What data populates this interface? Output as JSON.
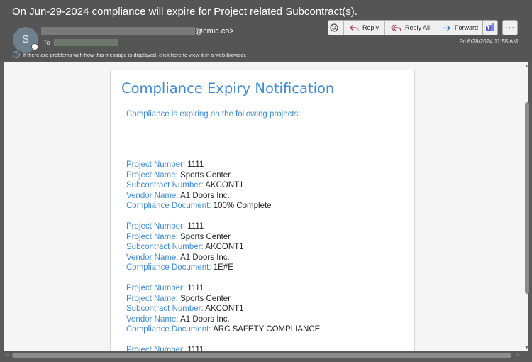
{
  "email": {
    "subject": "On Jun-29-2024 compliance will expire for Project related Subcontract(s).",
    "avatar_initial": "S",
    "sender_domain": "@cmic.ca>",
    "to_label": "To",
    "info_bar": "If there are problems with how this message is displayed, click here to view it in a web browser.",
    "date": "Fri 6/28/2024 11:55 AM"
  },
  "actions": {
    "reply": "Reply",
    "reply_all": "Reply All",
    "forward": "Forward",
    "more": "···"
  },
  "icons": {
    "emoji": "emoji-icon",
    "reply": "reply-icon",
    "reply_all": "reply-all-icon",
    "forward": "forward-icon",
    "teams": "teams-icon",
    "info": "info-icon"
  },
  "colors": {
    "accent_blue": "#3d8ad6",
    "header_bg": "#555555",
    "teams_purple": "#5b5fc7"
  },
  "notification": {
    "title": "Compliance Expiry Notification",
    "intro": "Compliance is expiring on the following projects:",
    "labels": {
      "project_number": "Project Number:",
      "project_name": "Project Name:",
      "subcontract_number": "Subcontract Number:",
      "vendor_name": "Vendor Name:",
      "compliance_document": "Compliance Document:"
    },
    "records": [
      {
        "project_number": "1111",
        "project_name": "Sports Center",
        "subcontract_number": "AKCONT1",
        "vendor_name": "A1 Doors Inc.",
        "compliance_document": "100% Complete"
      },
      {
        "project_number": "1111",
        "project_name": "Sports Center",
        "subcontract_number": "AKCONT1",
        "vendor_name": "A1 Doors Inc.",
        "compliance_document": "1E#E"
      },
      {
        "project_number": "1111",
        "project_name": "Sports Center",
        "subcontract_number": "AKCONT1",
        "vendor_name": "A1 Doors Inc.",
        "compliance_document": "ARC SAFETY COMPLIANCE"
      },
      {
        "project_number": "1111"
      }
    ]
  }
}
